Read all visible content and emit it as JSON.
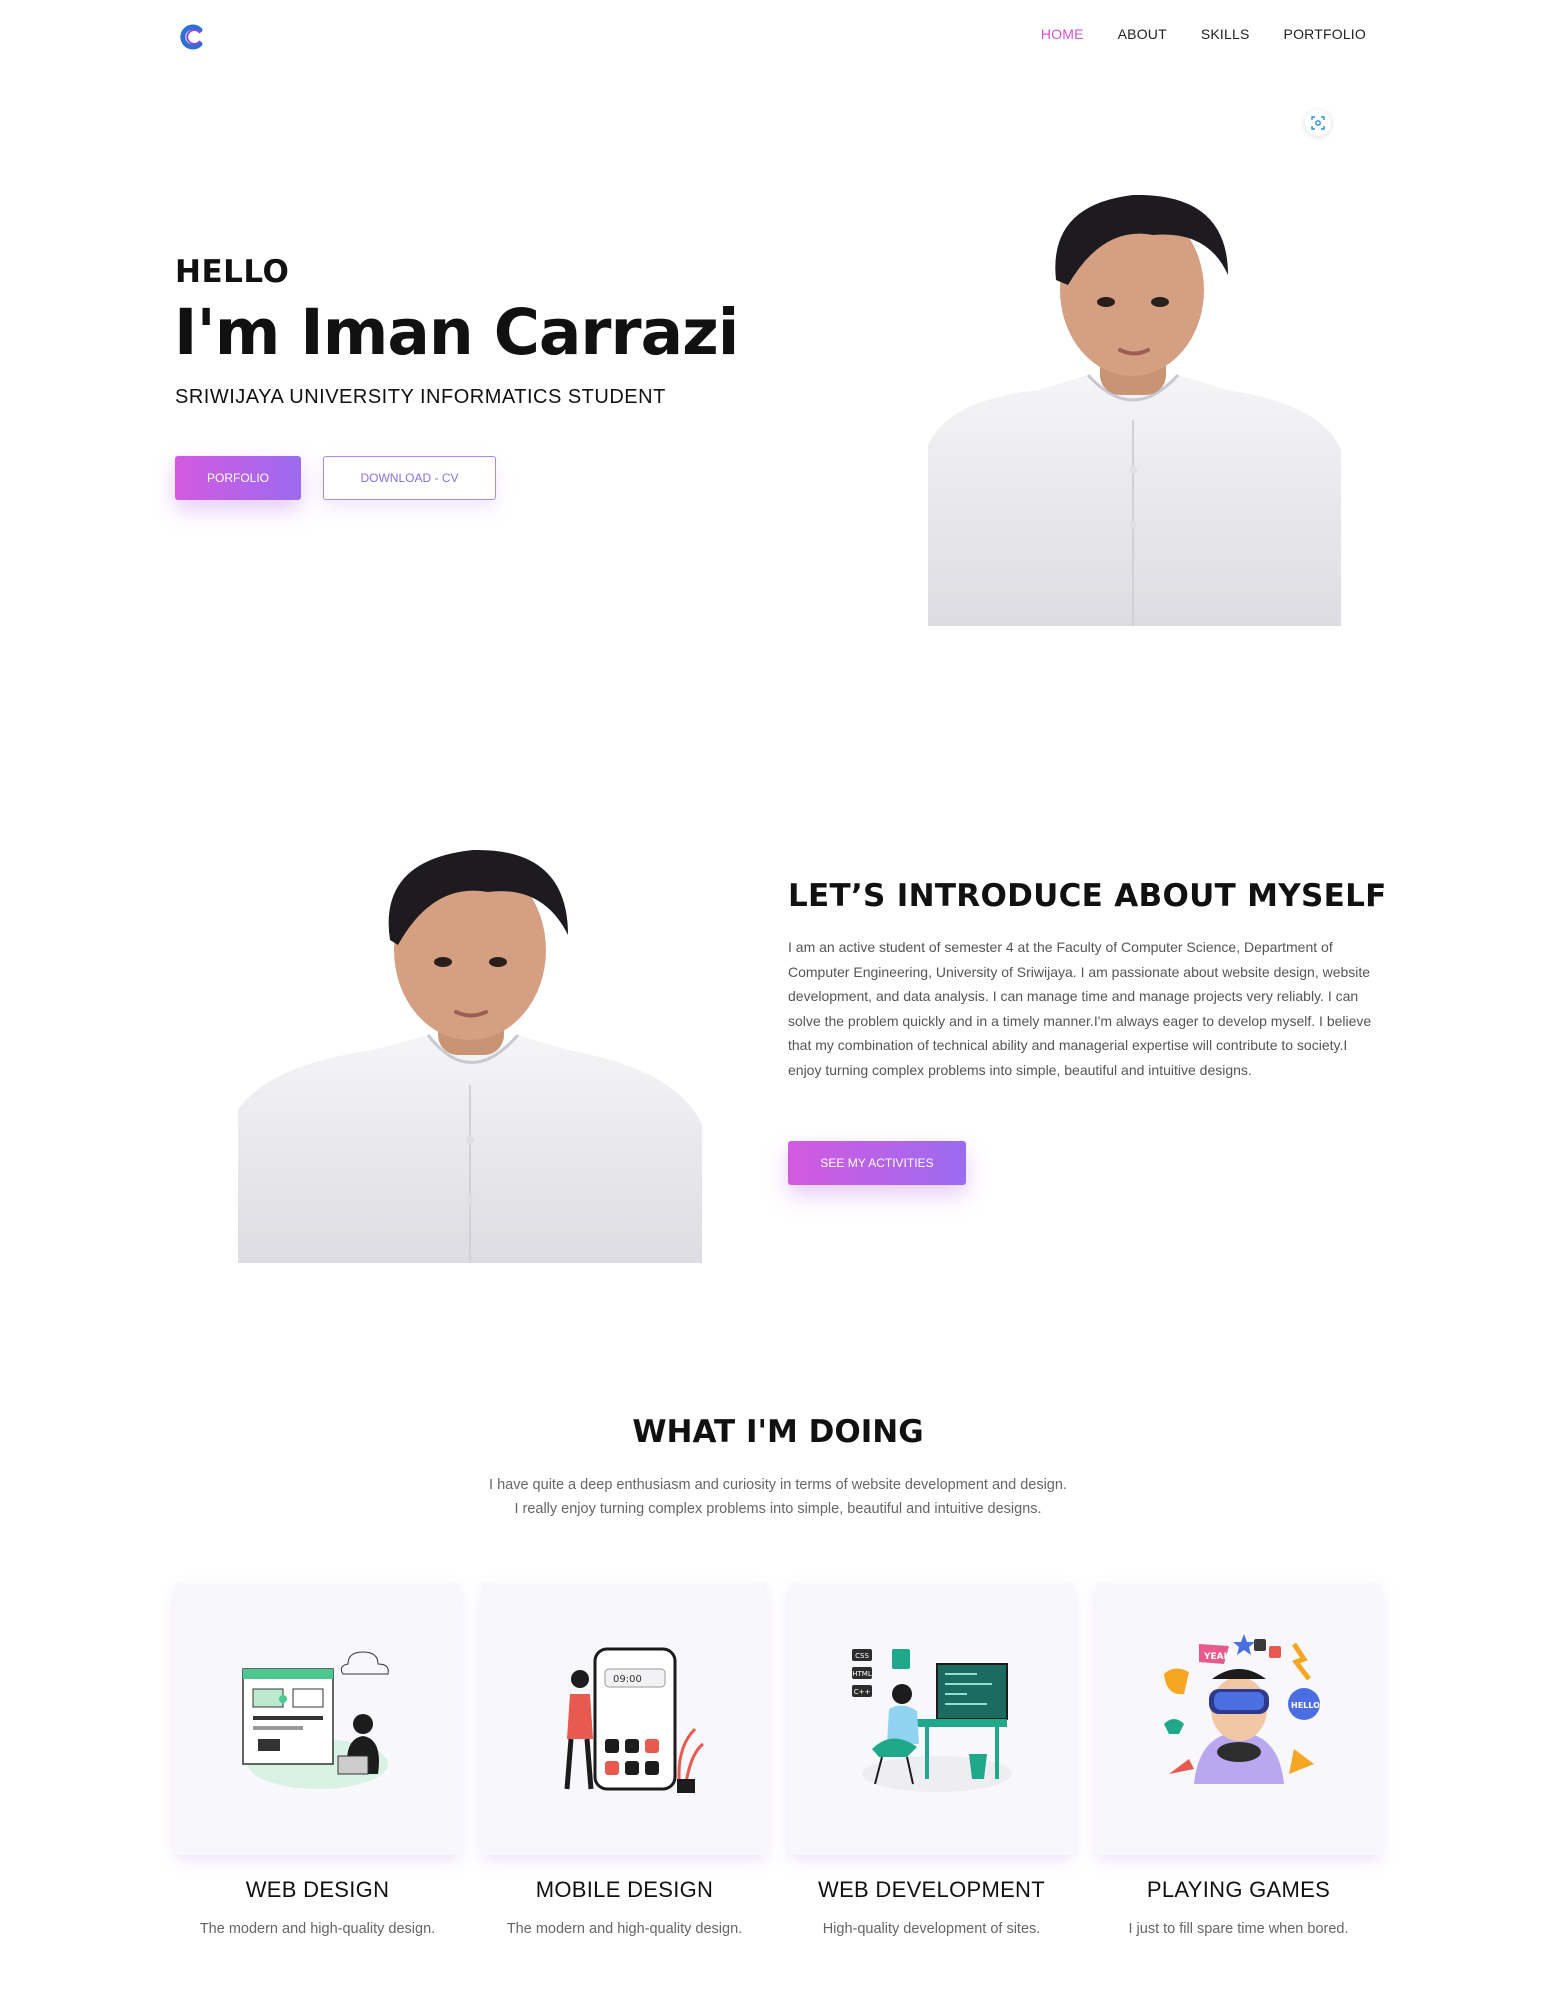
{
  "nav": {
    "items": [
      {
        "label": "HOME",
        "active": true
      },
      {
        "label": "ABOUT",
        "active": false
      },
      {
        "label": "SKILLS",
        "active": false
      },
      {
        "label": "PORTFOLIO",
        "active": false
      }
    ]
  },
  "hero": {
    "greeting": "HELLO",
    "name": "I'm Iman Carrazi",
    "tagline": "SRIWIJAYA UNIVERSITY INFORMATICS STUDENT",
    "portfolio_button": "PORFOLIO",
    "cv_button": "DOWNLOAD - CV"
  },
  "about": {
    "title": "LET’S INTRODUCE ABOUT MYSELF",
    "text": "I am an active student of semester 4 at the Faculty of Computer Science, Department of Computer Engineering, University of Sriwijaya. I am passionate about website design, website development, and data analysis. I can manage time and manage projects very reliably. I can solve the problem quickly and in a timely manner.I'm always eager to develop myself. I believe that my combination of technical ability and managerial expertise will contribute to society.I enjoy turning complex problems into simple, beautiful and intuitive designs.",
    "button": "SEE MY ACTIVITIES"
  },
  "doing": {
    "title": "WHAT I'M DOING",
    "subtitle_line1": "I have quite a deep enthusiasm and curiosity in terms of website development and design.",
    "subtitle_line2": "I really enjoy turning complex problems into simple, beautiful and intuitive designs.",
    "cards": [
      {
        "title": "WEB DESIGN",
        "desc": "The modern and high-quality design.",
        "illustration": "web-design-illustration"
      },
      {
        "title": "MOBILE DESIGN",
        "desc": "The modern and high-quality design.",
        "illustration": "mobile-design-illustration"
      },
      {
        "title": "WEB DEVELOPMENT",
        "desc": "High-quality development of sites.",
        "illustration": "web-development-illustration"
      },
      {
        "title": "PLAYING GAMES",
        "desc": "I just to fill spare time when bored.",
        "illustration": "playing-games-illustration"
      }
    ]
  },
  "illustration_text": {
    "phone_time": "09:00",
    "code_tags": [
      "CSS",
      "HTML",
      "C++"
    ],
    "game_bubbles": [
      "YEAH!",
      "HELLO!"
    ]
  },
  "colors": {
    "accent": "#d64fd4",
    "gradient_start": "#d35ae0",
    "gradient_end": "#9b6bf0",
    "card_bg": "#f8f7fc"
  }
}
